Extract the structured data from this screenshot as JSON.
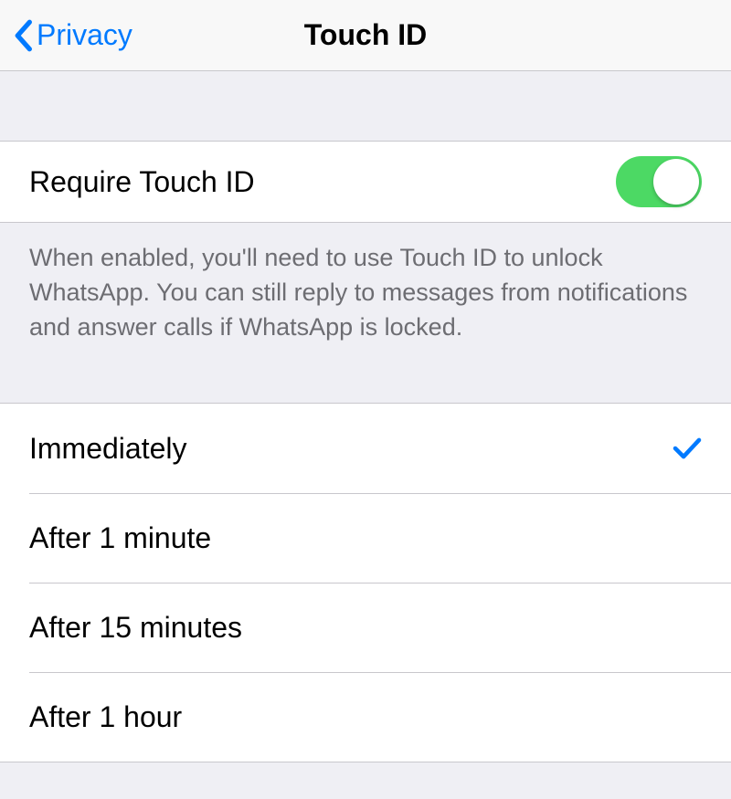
{
  "nav": {
    "back_label": "Privacy",
    "title": "Touch ID"
  },
  "toggle_section": {
    "label": "Require Touch ID",
    "enabled": true
  },
  "footer_text": "When enabled, you'll need to use Touch ID to unlock WhatsApp. You can still reply to messages from notifications and answer calls if WhatsApp is locked.",
  "options": [
    {
      "label": "Immediately",
      "selected": true
    },
    {
      "label": "After 1 minute",
      "selected": false
    },
    {
      "label": "After 15 minutes",
      "selected": false
    },
    {
      "label": "After 1 hour",
      "selected": false
    }
  ],
  "colors": {
    "accent": "#007aff",
    "toggle_on": "#4cd964",
    "background": "#efeff4"
  }
}
